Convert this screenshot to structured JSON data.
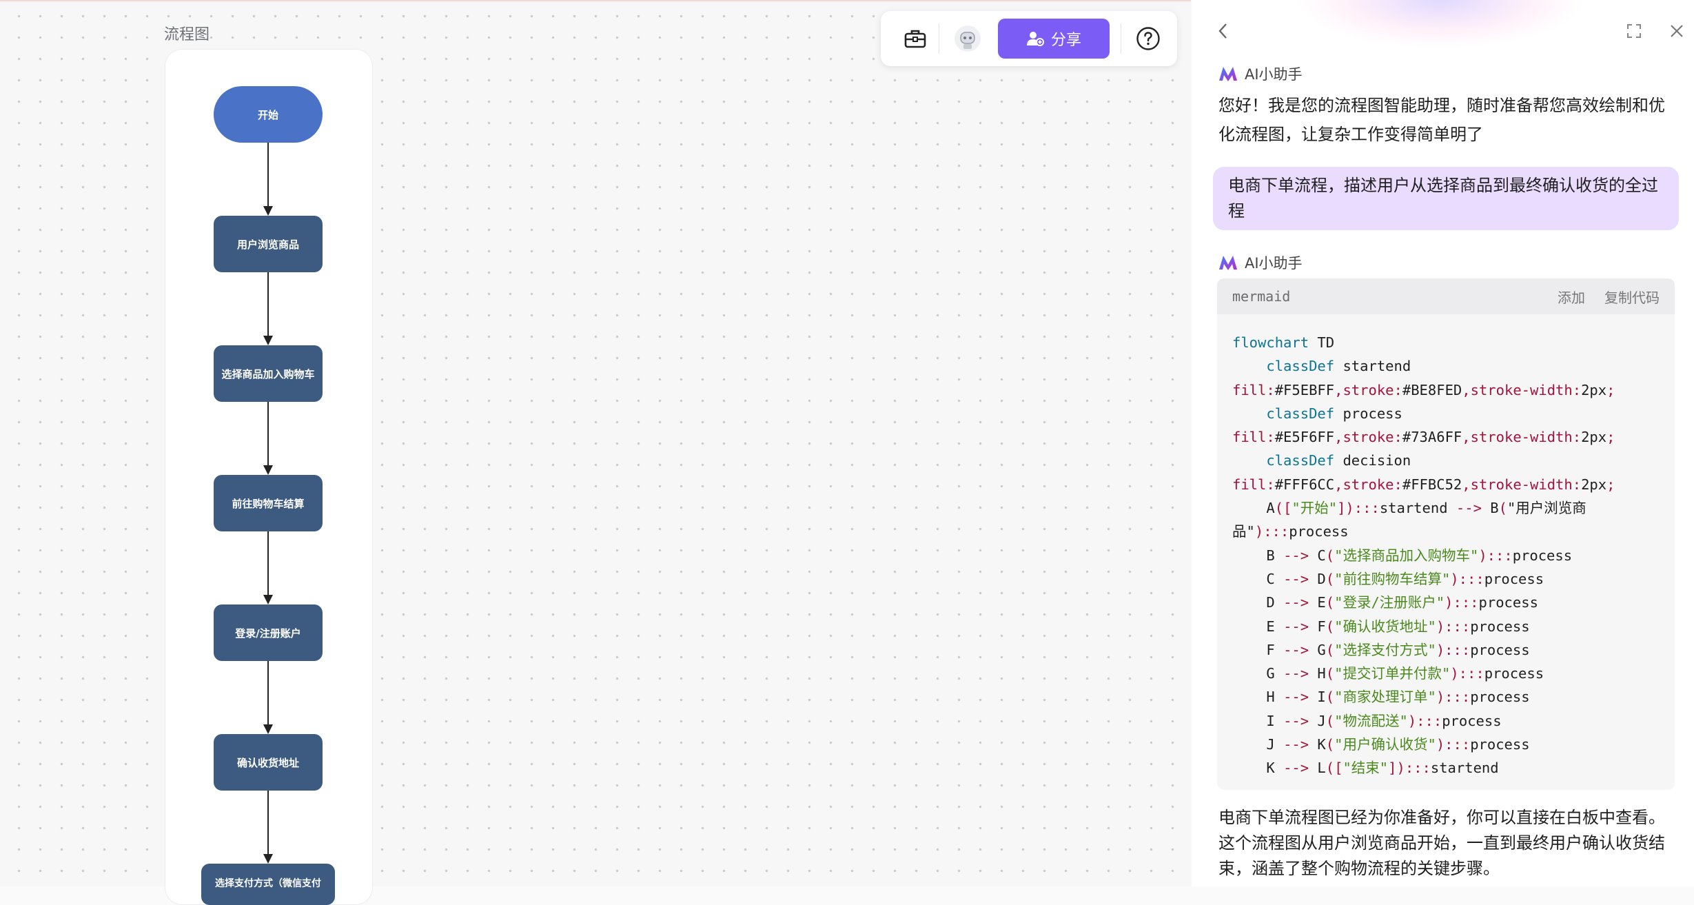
{
  "canvas": {
    "frame_title": "流程图",
    "nodes": [
      {
        "label": "开始",
        "kind": "start"
      },
      {
        "label": "用户浏览商品",
        "kind": "process"
      },
      {
        "label": "选择商品加入购物车",
        "kind": "process"
      },
      {
        "label": "前往购物车结算",
        "kind": "process"
      },
      {
        "label": "登录/注册账户",
        "kind": "process"
      },
      {
        "label": "确认收货地址",
        "kind": "process"
      },
      {
        "label": "选择支付方式（微信支付",
        "kind": "process"
      }
    ],
    "colors": {
      "start": "#4a72c7",
      "process": "#3d5a80"
    }
  },
  "toolbar": {
    "toolbox_icon": "toolbox-icon",
    "avatar_icon": "robot-avatar-icon",
    "share_label": "分享",
    "help_icon": "help-circle-icon",
    "accent": "#7b5cf5"
  },
  "panel": {
    "back_icon": "chevron-left-icon",
    "expand_icon": "expand-icon",
    "close_icon": "close-icon",
    "assistant_name": "AI小助手",
    "greeting": "您好！我是您的流程图智能助理，随时准备帮您高效绘制和优化流程图，让复杂工作变得简单明了",
    "user_message": "电商下单流程，描述用户从选择商品到最终确认收货的全过程",
    "code": {
      "lang": "mermaid",
      "add_label": "添加",
      "copy_label": "复制代码",
      "lines": [
        "flowchart TD",
        "    classDef startend",
        "fill:#F5EBFF,stroke:#BE8FED,stroke-width:2px;",
        "    classDef process",
        "fill:#E5F6FF,stroke:#73A6FF,stroke-width:2px;",
        "    classDef decision",
        "fill:#FFF6CC,stroke:#FFBC52,stroke-width:2px;",
        "    A([\"开始\"]):::startend --> B(\"用户浏览商",
        "品\"):::process",
        "    B --> C(\"选择商品加入购物车\"):::process",
        "    C --> D(\"前往购物车结算\"):::process",
        "    D --> E(\"登录/注册账户\"):::process",
        "    E --> F(\"确认收货地址\"):::process",
        "    F --> G(\"选择支付方式\"):::process",
        "    G --> H(\"提交订单并付款\"):::process",
        "    H --> I(\"商家处理订单\"):::process",
        "    I --> J(\"物流配送\"):::process",
        "    J --> K(\"用户确认收货\"):::process",
        "    K --> L([\"结束\"]):::startend"
      ]
    },
    "reply": "电商下单流程图已经为你准备好，你可以直接在白板中查看。这个流程图从用户浏览商品开始，一直到最终用户确认收货结束，涵盖了整个购物流程的关键步骤。"
  }
}
